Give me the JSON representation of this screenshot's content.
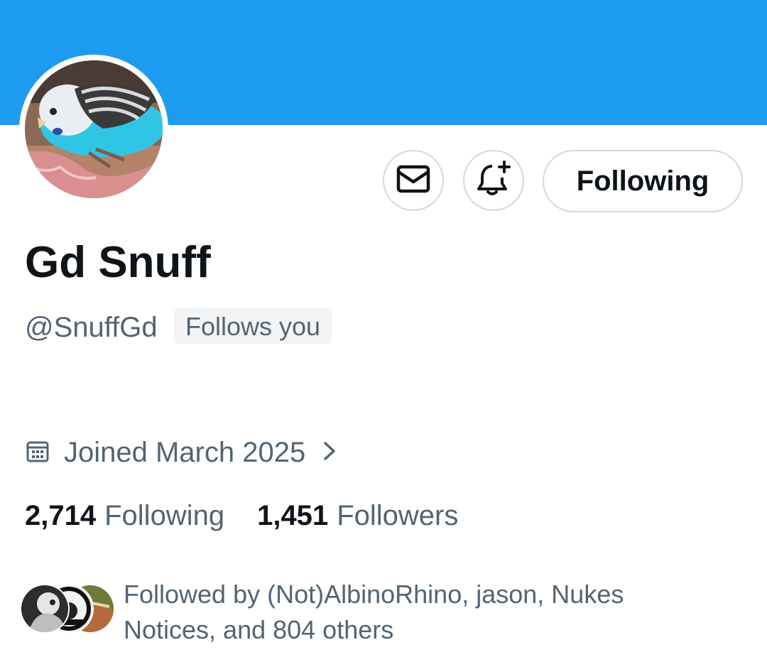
{
  "profile": {
    "display_name": "Gd Snuff",
    "handle": "@SnuffGd",
    "follows_you_badge": "Follows you",
    "joined": "Joined March 2025"
  },
  "actions": {
    "follow_state_label": "Following"
  },
  "stats": {
    "following_count": "2,714",
    "following_label": "Following",
    "followers_count": "1,451",
    "followers_label": "Followers"
  },
  "followed_by": {
    "text": "Followed by (Not)AlbinoRhino, jason, Nukes Notices, and 804 others"
  },
  "colors": {
    "banner": "#1d9bf0",
    "primary_text": "#0f1419",
    "secondary_text": "#536471",
    "border": "#cfd9de"
  },
  "icons": {
    "message": "envelope-icon",
    "notify": "bell-plus-icon",
    "joined": "calendar-icon",
    "more": "chevron-right-icon"
  }
}
